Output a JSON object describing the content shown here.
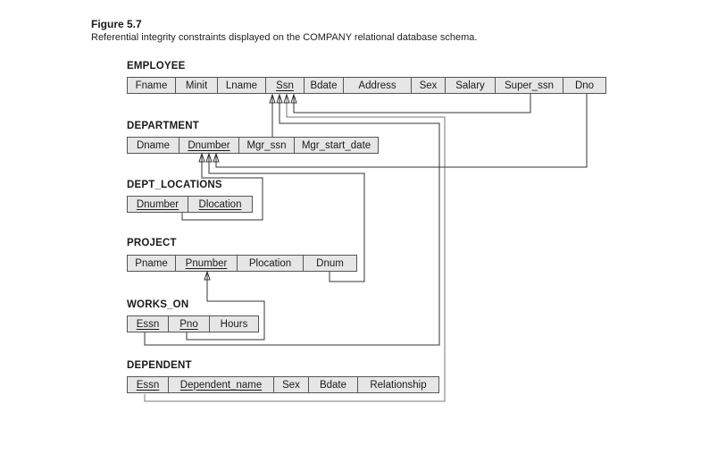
{
  "figure": {
    "title": "Figure 5.7",
    "caption": "Referential integrity constraints displayed on the COMPANY relational database schema."
  },
  "relations": {
    "employee": {
      "name": "EMPLOYEE",
      "attributes": [
        {
          "label": "Fname",
          "pk": false
        },
        {
          "label": "Minit",
          "pk": false
        },
        {
          "label": "Lname",
          "pk": false
        },
        {
          "label": "Ssn",
          "pk": true
        },
        {
          "label": "Bdate",
          "pk": false
        },
        {
          "label": "Address",
          "pk": false
        },
        {
          "label": "Sex",
          "pk": false
        },
        {
          "label": "Salary",
          "pk": false
        },
        {
          "label": "Super_ssn",
          "pk": false
        },
        {
          "label": "Dno",
          "pk": false
        }
      ]
    },
    "department": {
      "name": "DEPARTMENT",
      "attributes": [
        {
          "label": "Dname",
          "pk": false
        },
        {
          "label": "Dnumber",
          "pk": true
        },
        {
          "label": "Mgr_ssn",
          "pk": false
        },
        {
          "label": "Mgr_start_date",
          "pk": false
        }
      ]
    },
    "dept_locations": {
      "name": "DEPT_LOCATIONS",
      "attributes": [
        {
          "label": "Dnumber",
          "pk": true
        },
        {
          "label": "Dlocation",
          "pk": true
        }
      ]
    },
    "project": {
      "name": "PROJECT",
      "attributes": [
        {
          "label": "Pname",
          "pk": false
        },
        {
          "label": "Pnumber",
          "pk": true
        },
        {
          "label": "Plocation",
          "pk": false
        },
        {
          "label": "Dnum",
          "pk": false
        }
      ]
    },
    "works_on": {
      "name": "WORKS_ON",
      "attributes": [
        {
          "label": "Essn",
          "pk": true
        },
        {
          "label": "Pno",
          "pk": true
        },
        {
          "label": "Hours",
          "pk": false
        }
      ]
    },
    "dependent": {
      "name": "DEPENDENT",
      "attributes": [
        {
          "label": "Essn",
          "pk": true
        },
        {
          "label": "Dependent_name",
          "pk": true
        },
        {
          "label": "Sex",
          "pk": false
        },
        {
          "label": "Bdate",
          "pk": false
        },
        {
          "label": "Relationship",
          "pk": false
        }
      ]
    }
  },
  "foreign_keys": [
    {
      "from": "EMPLOYEE.Super_ssn",
      "to": "EMPLOYEE.Ssn"
    },
    {
      "from": "EMPLOYEE.Dno",
      "to": "DEPARTMENT.Dnumber"
    },
    {
      "from": "DEPARTMENT.Mgr_ssn",
      "to": "EMPLOYEE.Ssn"
    },
    {
      "from": "DEPT_LOCATIONS.Dnumber",
      "to": "DEPARTMENT.Dnumber"
    },
    {
      "from": "PROJECT.Dnum",
      "to": "DEPARTMENT.Dnumber"
    },
    {
      "from": "WORKS_ON.Essn",
      "to": "EMPLOYEE.Ssn"
    },
    {
      "from": "WORKS_ON.Pno",
      "to": "PROJECT.Pnumber"
    },
    {
      "from": "DEPENDENT.Essn",
      "to": "EMPLOYEE.Ssn"
    }
  ]
}
